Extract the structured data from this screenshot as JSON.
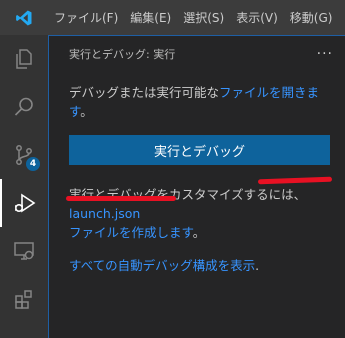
{
  "menu": {
    "items": [
      "ファイル(F)",
      "編集(E)",
      "選択(S)",
      "表示(V)",
      "移動(G)"
    ]
  },
  "activity": {
    "scm_badge": "4"
  },
  "sidebar": {
    "title": "実行とデバッグ: 実行",
    "more": "···",
    "intro_text": "デバッグまたは実行可能な",
    "intro_link": "ファイルを開きます",
    "intro_suffix": "。",
    "run_button": "実行とデバッグ",
    "customize_text": "実行とデバッグをカスタマイズするには、",
    "customize_link_1": "launch.json",
    "customize_link_2": "ファイルを作成します",
    "customize_suffix": "。",
    "show_all_link": "すべての自動デバッグ構成を表示",
    "show_all_suffix": "."
  },
  "colors": {
    "accent": "#0e639c",
    "link": "#3794ff",
    "annotation": "#e81123"
  }
}
